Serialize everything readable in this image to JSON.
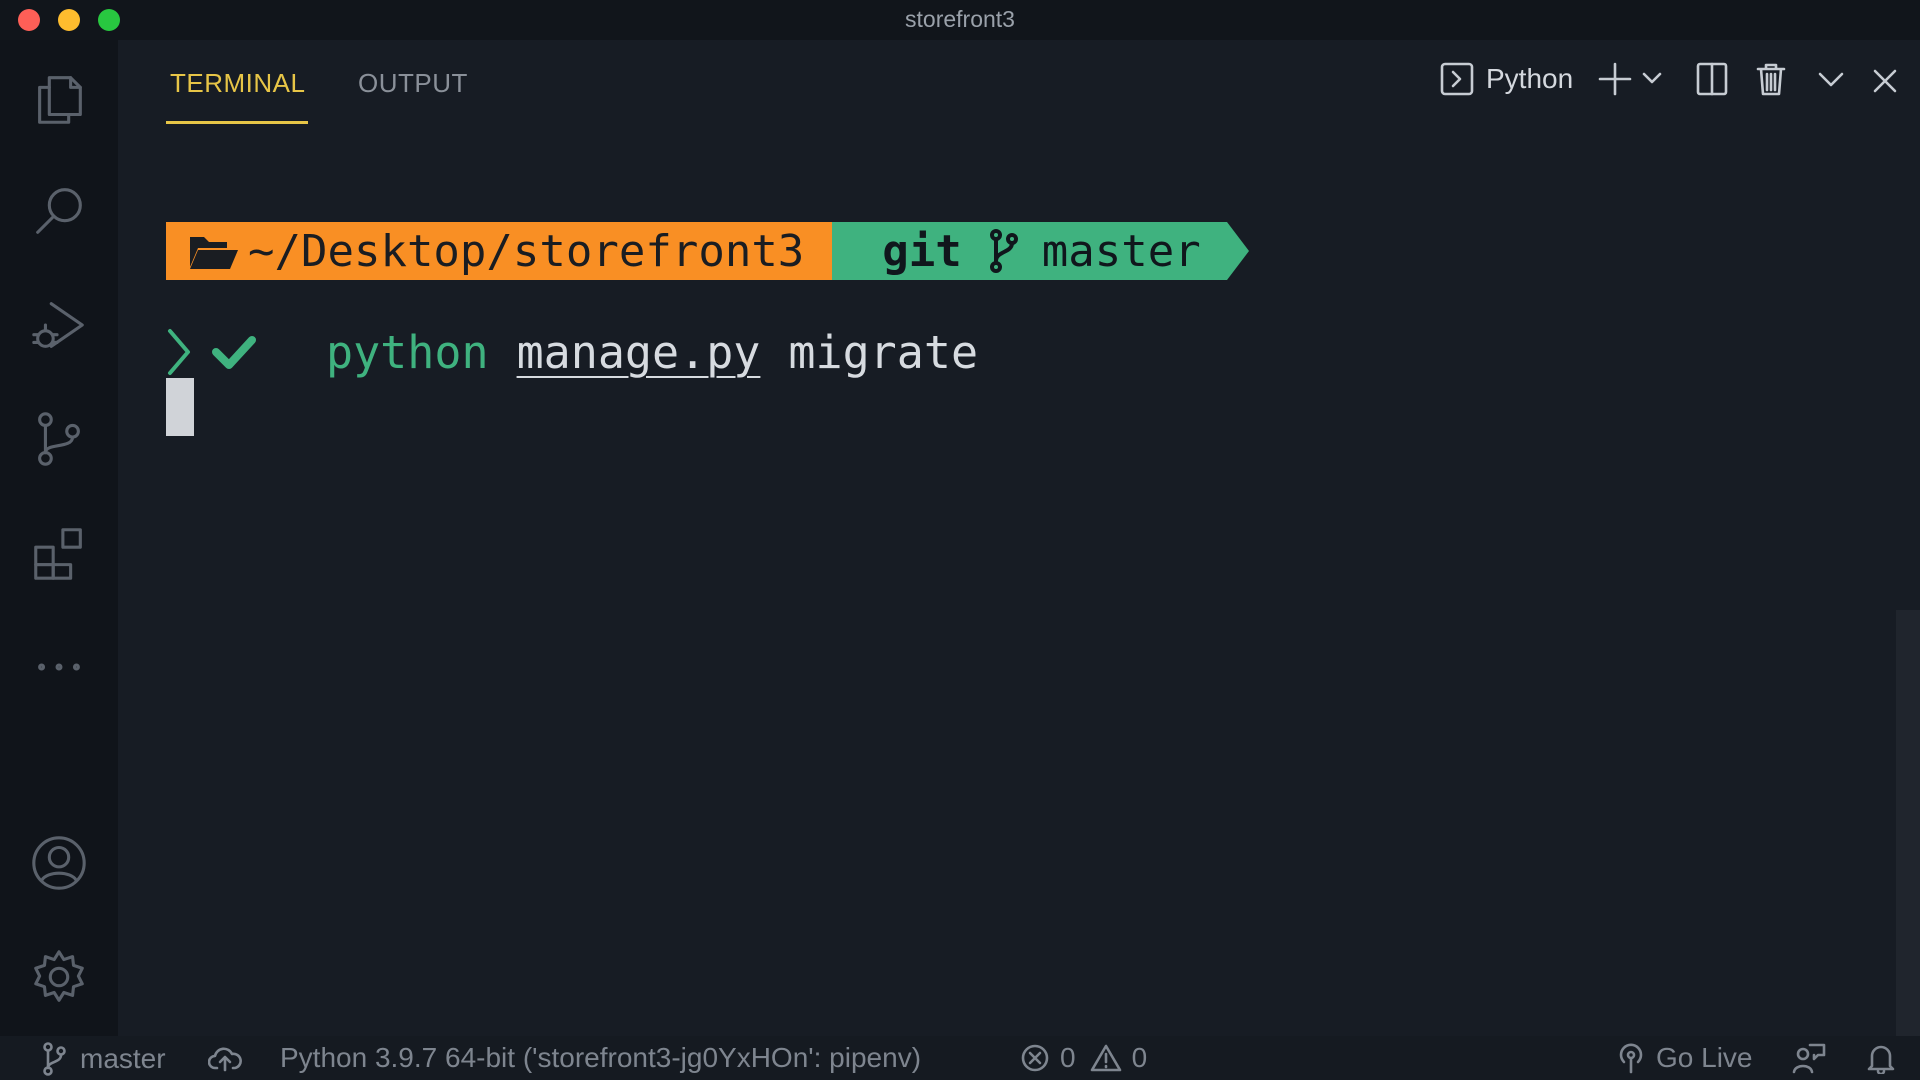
{
  "window": {
    "title": "storefront3"
  },
  "panel": {
    "tabs": [
      {
        "label": "TERMINAL",
        "active": true
      },
      {
        "label": "OUTPUT",
        "active": false
      }
    ],
    "toolbar": {
      "terminal_profile_icon": "terminal-icon",
      "terminal_profile_label": "Python",
      "actions": [
        "plus-icon",
        "chevron-down-icon",
        "split-icon",
        "trash-icon",
        "chevron-down-icon",
        "close-icon"
      ]
    }
  },
  "terminal": {
    "prompt": {
      "directory": "~/Desktop/storefront3",
      "git_label": "git",
      "branch": "master"
    },
    "command": {
      "program": "python",
      "file": "manage.py",
      "argument": "migrate"
    }
  },
  "activity_bar": {
    "icons": [
      "files-icon",
      "search-icon",
      "run-debug-icon",
      "source-control-icon",
      "extensions-icon",
      "more-icon",
      "account-icon",
      "settings-gear-icon"
    ]
  },
  "status_bar": {
    "branch": "master",
    "interpreter": "Python 3.9.7 64-bit ('storefront3-jg0YxHOn': pipenv)",
    "errors": "0",
    "warnings": "0",
    "go_live": "Go Live"
  },
  "colors": {
    "accent_tab": "#e7c547",
    "prompt_dir_bg": "#f98f24",
    "prompt_git_bg": "#3fb27f"
  }
}
